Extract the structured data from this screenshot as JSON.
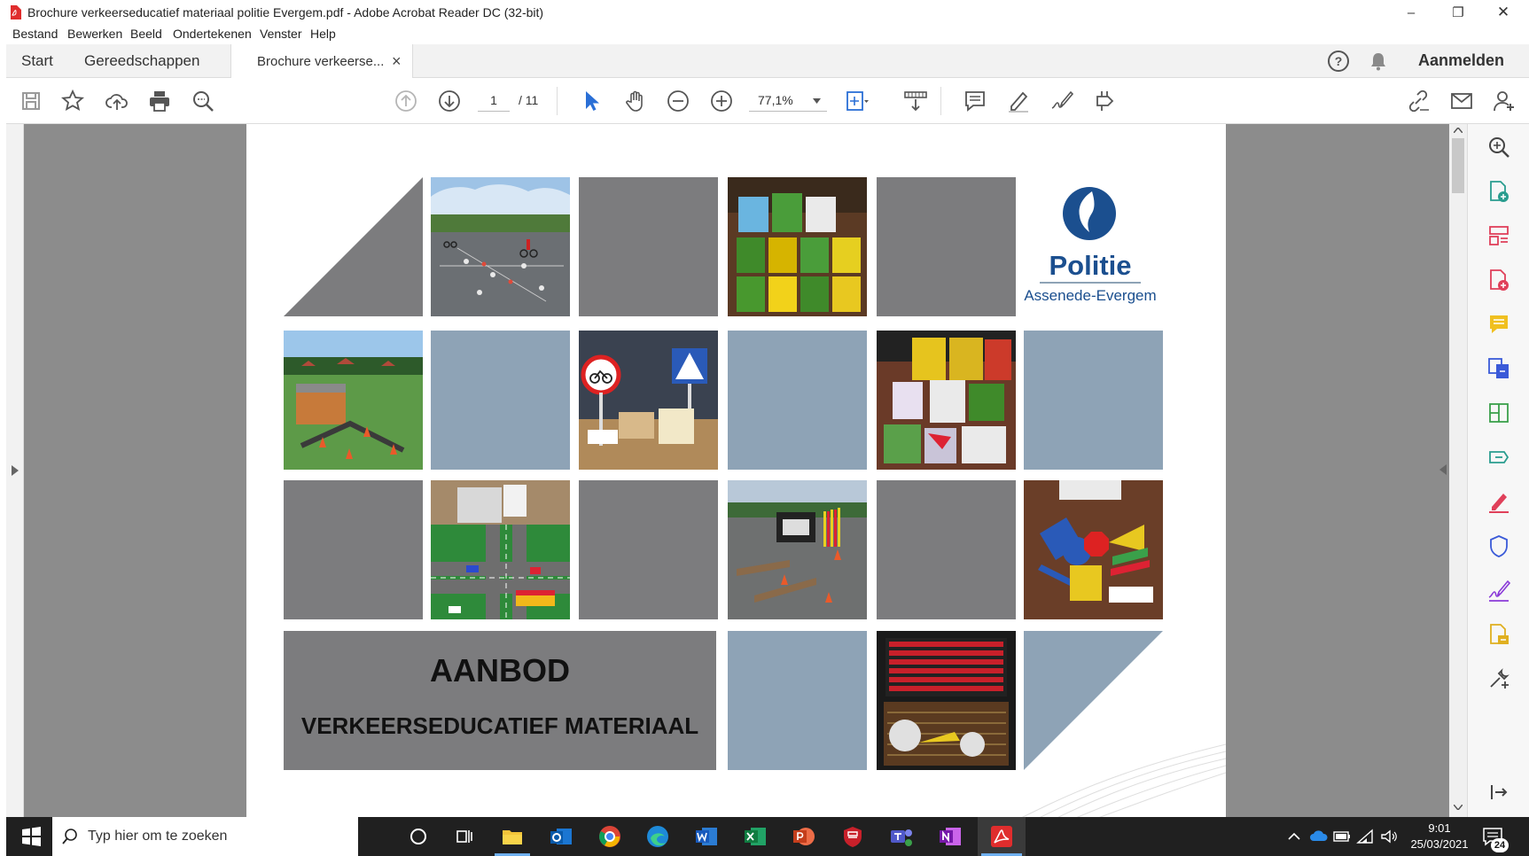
{
  "window": {
    "title": "Brochure verkeerseducatief materiaal politie Evergem.pdf - Adobe Acrobat Reader DC (32-bit)",
    "minimize_glyph": "–",
    "restore_glyph": "❐",
    "close_glyph": "✕"
  },
  "menu": [
    "Bestand",
    "Bewerken",
    "Beeld",
    "Ondertekenen",
    "Venster",
    "Help"
  ],
  "tabs": {
    "start": "Start",
    "tools": "Gereedschappen",
    "document": "Brochure verkeerse...",
    "close_glyph": "×",
    "signin": "Aanmelden",
    "help_glyph": "?"
  },
  "toolbar": {
    "page_current": "1",
    "page_total": "/ 11",
    "zoom": "77,1%"
  },
  "document": {
    "logo_name": "Politie",
    "logo_sub": "Assenede-Evergem",
    "title_line1": "AANBOD",
    "title_line2": "VERKEERSEDUCATIEF MATERIAAL"
  },
  "taskbar": {
    "search_placeholder": "Typ hier om te zoeken",
    "time": "9:01",
    "date": "25/03/2021",
    "notification_count": "24"
  },
  "colors": {
    "tile_grey": "#7c7c7e",
    "tile_blue": "#8ea3b6",
    "police_blue": "#1b4f8f",
    "acrobat_red": "#e02d2d",
    "cursor_blue": "#2a6fd6"
  }
}
